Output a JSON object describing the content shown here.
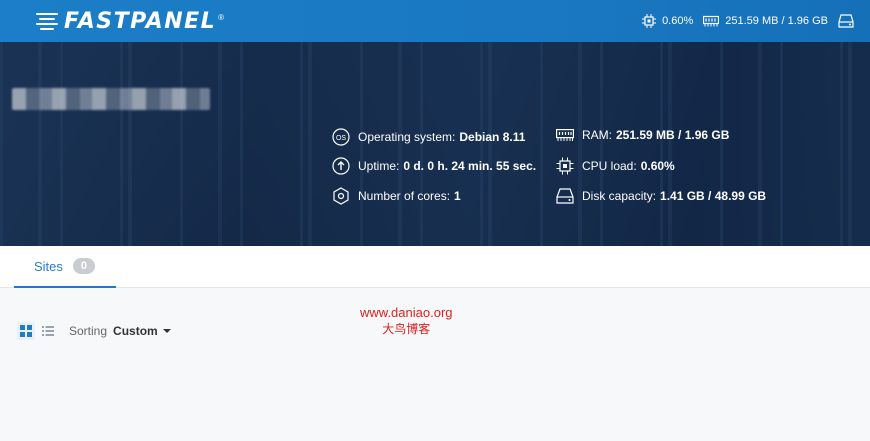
{
  "header": {
    "logo_text": "FASTPANEL",
    "logo_mark": "®",
    "cpu_usage": "0.60%",
    "ram_usage": "251.59 MB / 1.96 GB",
    "icons": [
      "cpu-chip-icon",
      "memory-icon",
      "disk-icon"
    ]
  },
  "server_info": {
    "os_label": "Operating system:",
    "os_value": "Debian 8.11",
    "uptime_label": "Uptime:",
    "uptime_value": "0 d. 0 h. 24 min. 55 sec.",
    "cores_label": "Number of cores:",
    "cores_value": "1",
    "ram_label": "RAM:",
    "ram_value": "251.59 MB / 1.96 GB",
    "cpu_label": "CPU load:",
    "cpu_value": "0.60%",
    "disk_label": "Disk capacity:",
    "disk_value": "1.41 GB / 48.99 GB"
  },
  "tabs": [
    {
      "label": "Sites",
      "count": "0",
      "active": true
    }
  ],
  "toolbar": {
    "sorting_label": "Sorting",
    "sorting_value": "Custom"
  },
  "watermark": {
    "line1": "www.daniao.org",
    "line2": "大鸟博客"
  },
  "colors": {
    "topbar": "#1c7ec8",
    "accent": "#1f7ac8",
    "badge": "#c9cdd2",
    "watermark": "#e02020"
  }
}
